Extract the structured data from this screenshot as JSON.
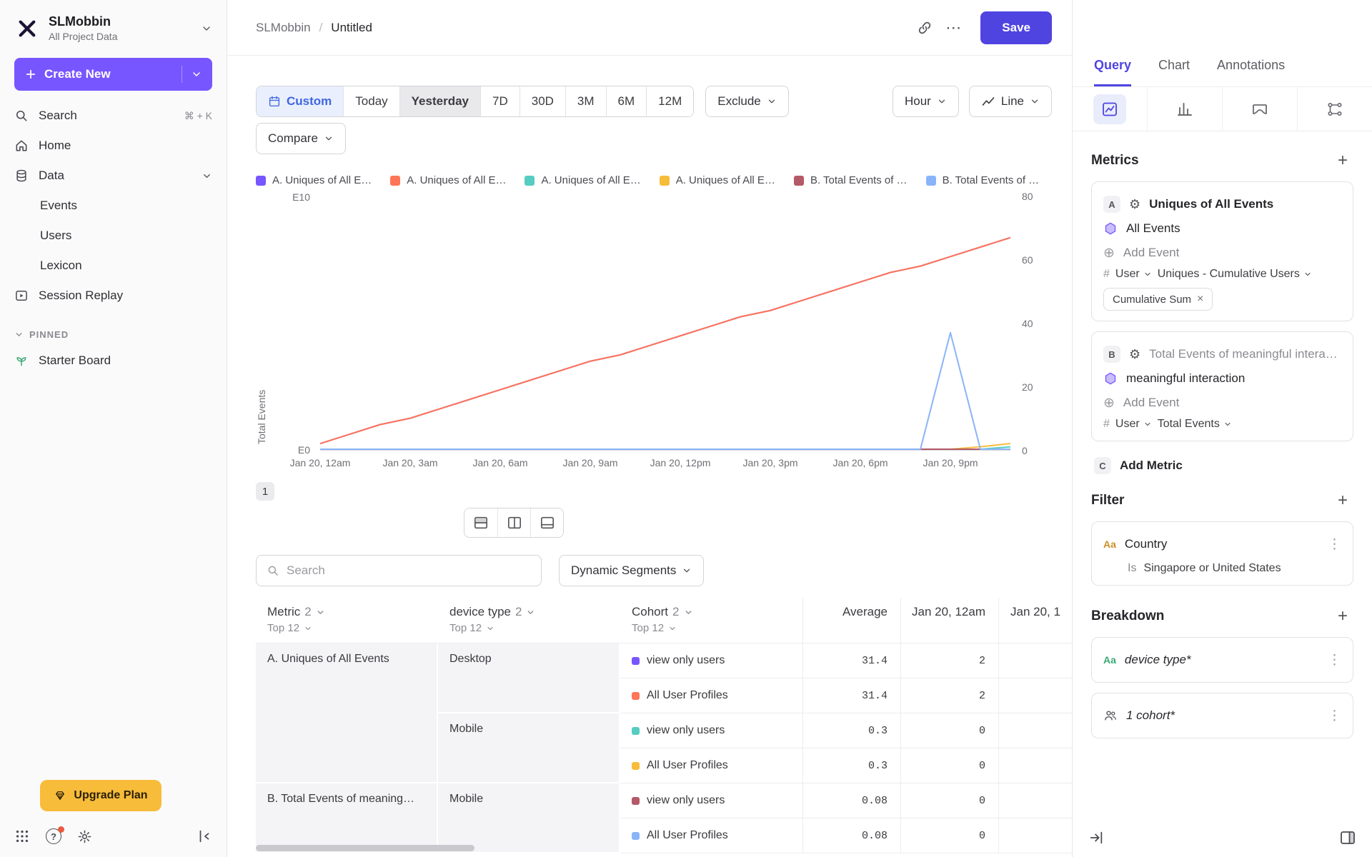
{
  "colors": {
    "accent_blue": "#4f44e0",
    "brand_purple": "#7856ff",
    "amber": "#f8bc3b"
  },
  "icons": {
    "gear": "⚙",
    "kebab": "⋮",
    "ellipsis": "⋯",
    "plus": "+",
    "circle_plus": "⊕",
    "close": "×",
    "string_type": "Aa",
    "number_type": "#",
    "help": "?"
  },
  "sidebar": {
    "workspace_name": "SLMobbin",
    "workspace_subtitle": "All Project Data",
    "create_new_label": "Create New",
    "search_label": "Search",
    "search_shortcut": "⌘ + K",
    "home_label": "Home",
    "data_label": "Data",
    "events_label": "Events",
    "users_label": "Users",
    "lexicon_label": "Lexicon",
    "session_replay_label": "Session Replay",
    "pinned_label": "PINNED",
    "starter_board_label": "Starter Board",
    "upgrade_label": "Upgrade Plan"
  },
  "header": {
    "breadcrumb_project": "SLMobbin",
    "breadcrumb_sep": "/",
    "breadcrumb_page": "Untitled",
    "save_label": "Save"
  },
  "toolbar": {
    "ranges": [
      "Custom",
      "Today",
      "Yesterday",
      "7D",
      "30D",
      "3M",
      "6M",
      "12M"
    ],
    "exclude_label": "Exclude",
    "granularity_label": "Hour",
    "chart_type_label": "Line",
    "compare_label": "Compare"
  },
  "legend": [
    {
      "label": "A. Uniques of All E…",
      "color": "#7856ff"
    },
    {
      "label": "A. Uniques of All E…",
      "color": "#ff7557"
    },
    {
      "label": "A. Uniques of All E…",
      "color": "#56cdc0"
    },
    {
      "label": "A. Uniques of All E…",
      "color": "#f8bc3b"
    },
    {
      "label": "B. Total Events of …",
      "color": "#b35a66"
    },
    {
      "label": "B. Total Events of …",
      "color": "#8ab4f8"
    }
  ],
  "chart_data": {
    "type": "line",
    "title": "",
    "xlabel": "",
    "ylabel": "Total Events",
    "y_left_labels": [
      "E10",
      "E0"
    ],
    "y_right_ticks": [
      0,
      20,
      40,
      60,
      80
    ],
    "ylim": [
      0,
      80
    ],
    "x_ticks": [
      "Jan 20, 12am",
      "Jan 20, 3am",
      "Jan 20, 6am",
      "Jan 20, 9am",
      "Jan 20, 12pm",
      "Jan 20, 3pm",
      "Jan 20, 6pm",
      "Jan 20, 9pm"
    ],
    "tick_interval_hours": 3,
    "x_hours_span": 23,
    "grid": false,
    "legend_position": "top",
    "series": [
      {
        "name": "A. Uniques of All Events · Desktop · view only users",
        "color": "#7856ff",
        "values": [
          2,
          5,
          8,
          10,
          13,
          16,
          19,
          22,
          25,
          28,
          30,
          33,
          36,
          39,
          42,
          44,
          47,
          50,
          53,
          56,
          58,
          61,
          64,
          67
        ]
      },
      {
        "name": "A. Uniques of All Events · Desktop · All User Profiles",
        "color": "#ff7557",
        "values": [
          2,
          5,
          8,
          10,
          13,
          16,
          19,
          22,
          25,
          28,
          30,
          33,
          36,
          39,
          42,
          44,
          47,
          50,
          53,
          56,
          58,
          61,
          64,
          67
        ]
      },
      {
        "name": "A. Uniques of All Events · Mobile · view only users",
        "color": "#56cdc0",
        "values": [
          0,
          0,
          0,
          0,
          0,
          0,
          0,
          0,
          0,
          0,
          0,
          0,
          0,
          0,
          0,
          0,
          0,
          0,
          0,
          0,
          0,
          0,
          0,
          1
        ]
      },
      {
        "name": "A. Uniques of All Events · Mobile · All User Profiles",
        "color": "#f8bc3b",
        "values": [
          0,
          0,
          0,
          0,
          0,
          0,
          0,
          0,
          0,
          0,
          0,
          0,
          0,
          0,
          0,
          0,
          0,
          0,
          0,
          0,
          0,
          0,
          1,
          2
        ]
      },
      {
        "name": "B. Total Events of meaningful interaction · Mobile · view only users",
        "color": "#b35a66",
        "values": [
          0,
          0,
          0,
          0,
          0,
          0,
          0,
          0,
          0,
          0,
          0,
          0,
          0,
          0,
          0,
          0,
          0,
          0,
          0,
          0,
          0,
          0,
          0,
          0
        ]
      },
      {
        "name": "B. Total Events of meaningful interaction · Mobile · All User Profiles",
        "color": "#8ab4f8",
        "values": [
          0,
          0,
          0,
          0,
          0,
          0,
          0,
          0,
          0,
          0,
          0,
          0,
          0,
          0,
          0,
          0,
          0,
          0,
          0,
          0,
          0,
          37,
          0,
          0
        ]
      }
    ]
  },
  "table": {
    "search_placeholder": "Search",
    "segments_label": "Dynamic Segments",
    "pagination": "1",
    "columns": {
      "metric": "Metric",
      "metric_count": "2",
      "device": "device type",
      "device_count": "2",
      "cohort": "Cohort",
      "cohort_count": "2",
      "top": "Top 12",
      "average": "Average",
      "col1": "Jan 20, 12am",
      "col2": "Jan 20, 1"
    },
    "groups": {
      "metric_a": "A. Uniques of All Events",
      "metric_b": "B. Total Events of meaning…",
      "device_desktop": "Desktop",
      "device_mobile1": "Mobile",
      "device_mobile2": "Mobile"
    },
    "rows": [
      {
        "cohort": "view only users",
        "color": "#7856ff",
        "avg": "31.4",
        "v1": "2"
      },
      {
        "cohort": "All User Profiles",
        "color": "#ff7557",
        "avg": "31.4",
        "v1": "2"
      },
      {
        "cohort": "view only users",
        "color": "#56cdc0",
        "avg": "0.3",
        "v1": "0"
      },
      {
        "cohort": "All User Profiles",
        "color": "#f8bc3b",
        "avg": "0.3",
        "v1": "0"
      },
      {
        "cohort": "view only users",
        "color": "#b35a66",
        "avg": "0.08",
        "v1": "0"
      },
      {
        "cohort": "All User Profiles",
        "color": "#8ab4f8",
        "avg": "0.08",
        "v1": "0"
      }
    ]
  },
  "query_panel": {
    "tabs": [
      "Query",
      "Chart",
      "Annotations"
    ],
    "metrics_title": "Metrics",
    "metric_a": {
      "badge": "A",
      "title": "Uniques of All Events",
      "event": "All Events",
      "add_event": "Add Event",
      "agg_entity": "User",
      "agg_type": "Uniques - Cumulative Users",
      "chip": "Cumulative Sum"
    },
    "metric_b": {
      "badge": "B",
      "title": "Total Events of meaningful interact…",
      "event": "meaningful interaction",
      "add_event": "Add Event",
      "agg_entity": "User",
      "agg_type": "Total Events"
    },
    "add_metric": {
      "badge": "C",
      "label": "Add Metric"
    },
    "filter_title": "Filter",
    "filter": {
      "name": "Country",
      "operator": "Is",
      "value": "Singapore or United States"
    },
    "breakdown_title": "Breakdown",
    "breakdowns": [
      {
        "name": "device type*"
      },
      {
        "name": "1 cohort*"
      }
    ]
  }
}
